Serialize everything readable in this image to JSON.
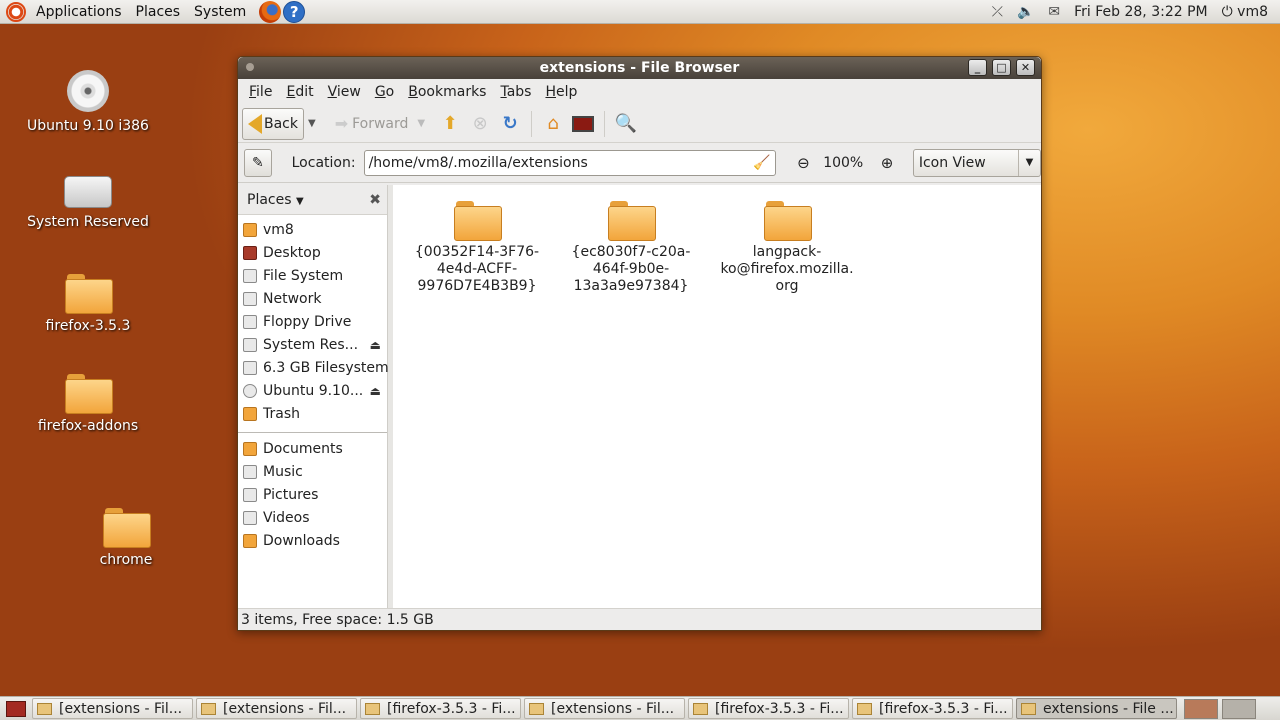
{
  "top_panel": {
    "menus": [
      "Applications",
      "Places",
      "System"
    ],
    "datetime": "Fri Feb 28,  3:22 PM",
    "user": "vm8",
    "icons": [
      "ubuntu-logo",
      "firefox-icon",
      "help-icon",
      "network-icon",
      "volume-icon",
      "mail-icon",
      "power-icon"
    ]
  },
  "desktop": {
    "icons": [
      {
        "label": "Ubuntu 9.10 i386",
        "icon": "cd-icon"
      },
      {
        "label": "System Reserved",
        "icon": "drive-icon"
      },
      {
        "label": "firefox-3.5.3",
        "icon": "folder-icon"
      },
      {
        "label": "firefox-addons",
        "icon": "folder-icon"
      },
      {
        "label": "chrome",
        "icon": "folder-icon"
      }
    ]
  },
  "window": {
    "title": "extensions - File Browser",
    "menu": [
      "File",
      "Edit",
      "View",
      "Go",
      "Bookmarks",
      "Tabs",
      "Help"
    ],
    "toolbar": {
      "back_label": "Back",
      "forward_label": "Forward"
    },
    "location": {
      "label": "Location:",
      "value": "/home/vm8/.mozilla/extensions",
      "zoom": "100%",
      "view_mode": "Icon View"
    },
    "sidebar": {
      "header": "Places",
      "items": [
        {
          "label": "vm8",
          "icon": "home-icon"
        },
        {
          "label": "Desktop",
          "icon": "desktop-icon"
        },
        {
          "label": "File System",
          "icon": "filesystem-icon"
        },
        {
          "label": "Network",
          "icon": "network-icon"
        },
        {
          "label": "Floppy Drive",
          "icon": "floppy-icon"
        },
        {
          "label": "System Res...",
          "icon": "drive-icon",
          "eject": true
        },
        {
          "label": "6.3 GB Filesystem",
          "icon": "drive-icon"
        },
        {
          "label": "Ubuntu 9.10...",
          "icon": "cd-icon",
          "eject": true
        },
        {
          "label": "Trash",
          "icon": "trash-icon"
        }
      ],
      "bookmarks": [
        {
          "label": "Documents",
          "icon": "folder-icon"
        },
        {
          "label": "Music",
          "icon": "music-icon"
        },
        {
          "label": "Pictures",
          "icon": "pictures-icon"
        },
        {
          "label": "Videos",
          "icon": "videos-icon"
        },
        {
          "label": "Downloads",
          "icon": "folder-icon"
        }
      ]
    },
    "files": [
      {
        "name_lines": [
          "{00352F14-3F76-",
          "4e4d-ACFF-",
          "9976D7E4B3B9}"
        ]
      },
      {
        "name_lines": [
          "{ec8030f7-c20a-",
          "464f-9b0e-",
          "13a3a9e97384}"
        ]
      },
      {
        "name_lines": [
          "langpack-",
          "ko@firefox.mozilla.",
          "org"
        ]
      }
    ],
    "status": "3 items, Free space: 1.5 GB"
  },
  "taskbar": {
    "tasks": [
      {
        "label": "[extensions - Fil..."
      },
      {
        "label": "[extensions - Fil..."
      },
      {
        "label": "[firefox-3.5.3 - Fi..."
      },
      {
        "label": "[extensions - Fil..."
      },
      {
        "label": "[firefox-3.5.3 - Fi..."
      },
      {
        "label": "[firefox-3.5.3 - Fi..."
      },
      {
        "label": "extensions - File ..."
      }
    ]
  },
  "colors": {
    "desktop_bg": "#e08a25",
    "titlebar": "#48413a",
    "folder": "#f2a53b"
  }
}
